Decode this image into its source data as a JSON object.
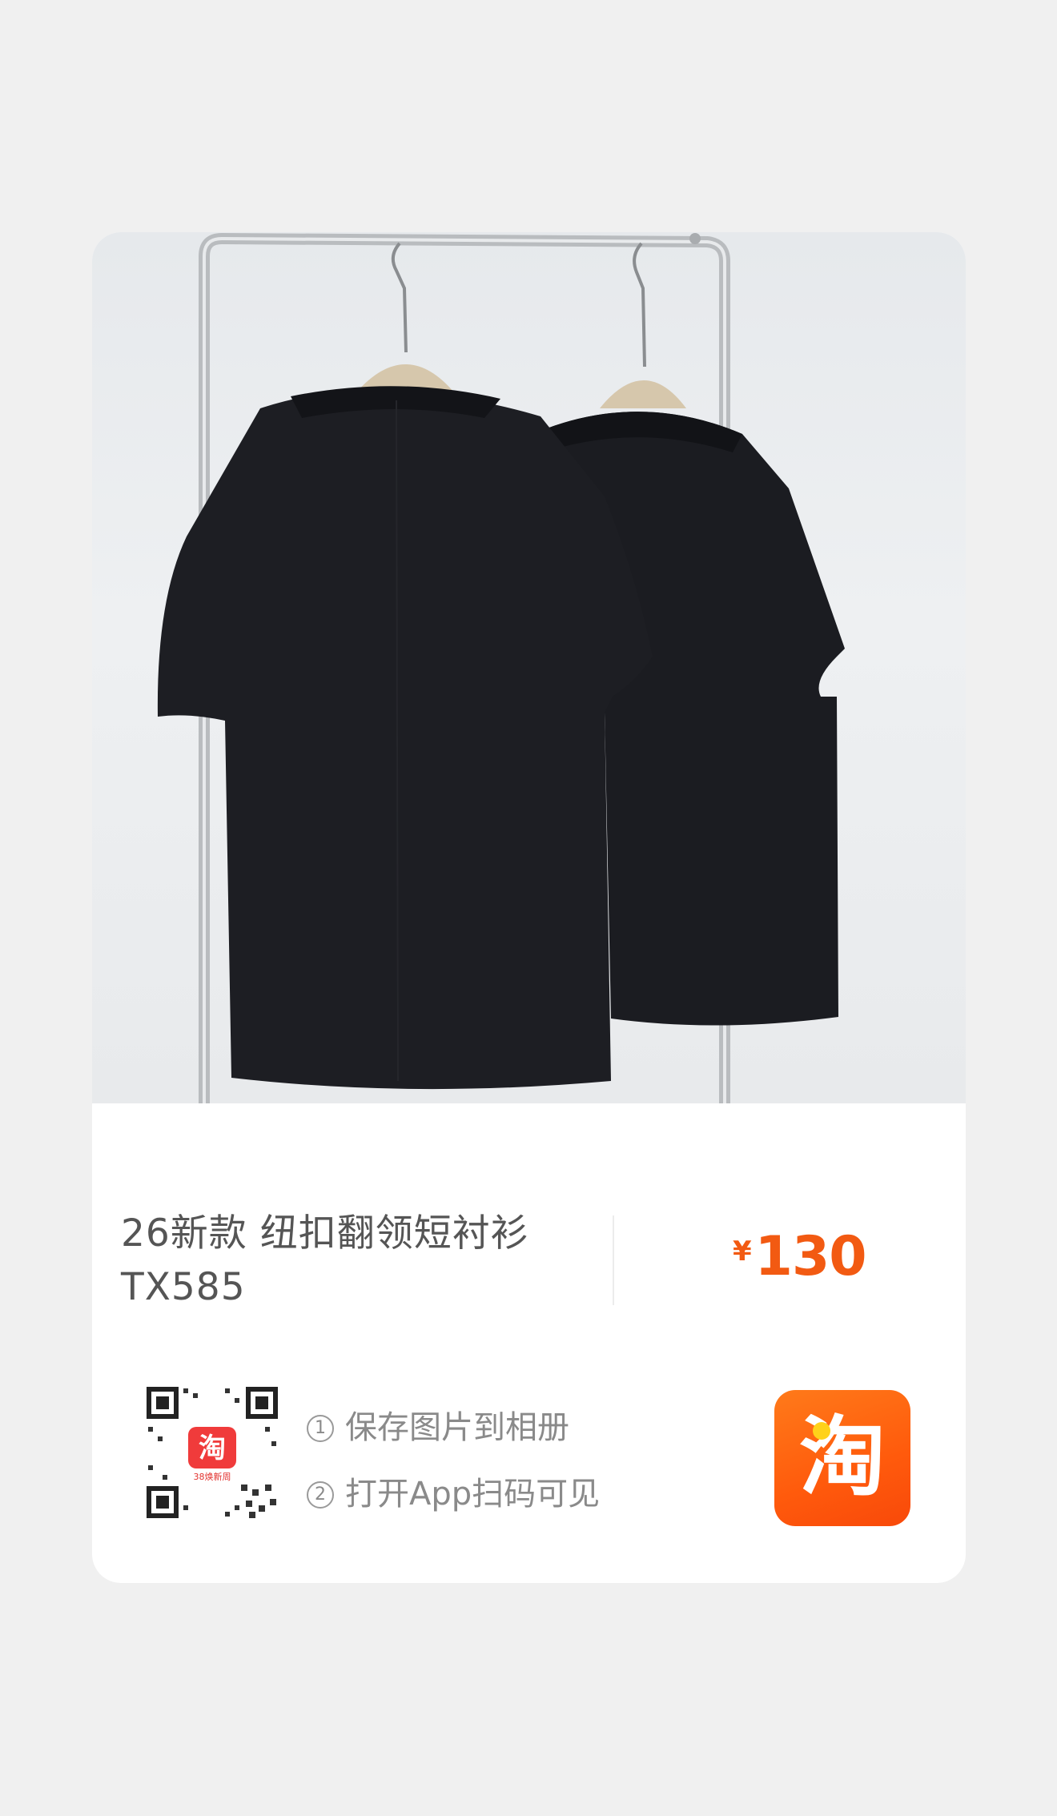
{
  "product": {
    "title": "26新款 纽扣翻领短衬衫 TX585",
    "price_symbol": "¥",
    "price": "130"
  },
  "qr": {
    "badge_text": "38焕新周",
    "logo_char": "淘"
  },
  "steps": [
    {
      "num": "1",
      "text": "保存图片到相册"
    },
    {
      "num": "2",
      "text": "打开App扫码可见"
    }
  ],
  "app_icon": {
    "name": "taobao-icon",
    "glyph": "淘"
  },
  "colors": {
    "accent": "#f25a12",
    "icon_bg": "#ff5a0c"
  }
}
